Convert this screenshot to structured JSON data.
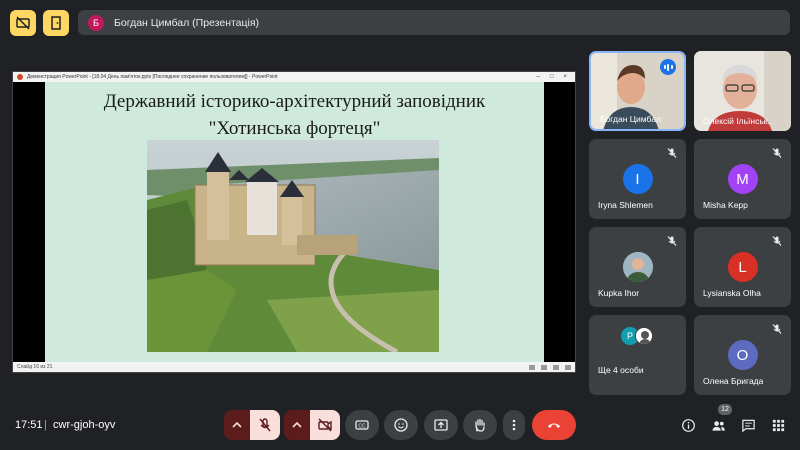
{
  "presenter": {
    "avatar_letter": "Б",
    "banner": "Богдан Цимбал (Презентація)"
  },
  "ppt": {
    "window_title": "Демонстрация PowerPoint - [18.04 День пам'яток.pptx [Последнее сохранение пользователем]] - PowerPoint",
    "slide_title_line1": "Державний історико-архітектурний заповідник",
    "slide_title_line2": "\"Хотинська фортеця\"",
    "slide_counter": "Слайд 16 из 21"
  },
  "participants": [
    {
      "name": "Богдан Цимбал",
      "type": "video",
      "speaking": true
    },
    {
      "name": "Олексій Ільїнськ...",
      "type": "video",
      "speaking": false
    },
    {
      "name": "Iryna Shlemen",
      "letter": "I",
      "color": "#1a73e8",
      "muted": true
    },
    {
      "name": "Misha Kepp",
      "letter": "M",
      "color": "#a142f4",
      "muted": true
    },
    {
      "name": "Kupka Ihor",
      "type": "photo",
      "muted": true
    },
    {
      "name": "Lysianska Olha",
      "letter": "L",
      "color": "#d93025",
      "muted": true
    },
    {
      "name": "Ще 4 особи",
      "letter": "P",
      "type": "more"
    },
    {
      "name": "Олена Бригада",
      "letter": "О",
      "color": "#5c6bc0",
      "muted": true
    }
  ],
  "bottom": {
    "time": "17:51",
    "separator": "|",
    "meeting_code": "cwr-gjoh-oyv",
    "people_count": "12"
  },
  "colors": {
    "accent_red": "#ea4335",
    "muted_bg": "#f9dedc",
    "control_bg": "#3c4043",
    "dark_red": "#5c1c1c"
  }
}
